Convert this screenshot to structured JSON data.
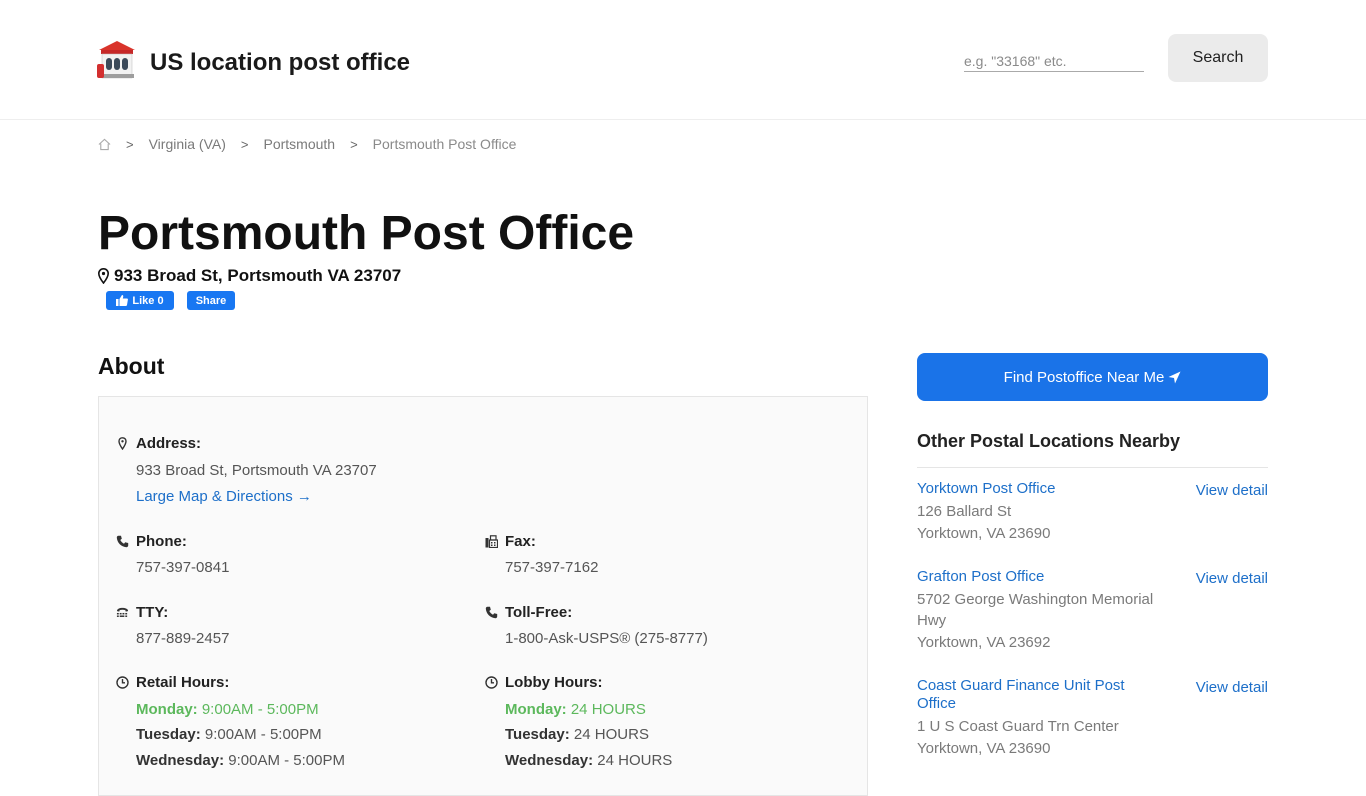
{
  "header": {
    "site_title": "US location post office",
    "search_placeholder": "e.g. \"33168\" etc.",
    "search_button": "Search"
  },
  "breadcrumb": {
    "items": [
      "Virginia (VA)",
      "Portsmouth"
    ],
    "current": "Portsmouth Post Office",
    "separator": ">"
  },
  "page": {
    "title": "Portsmouth Post Office",
    "address": "933 Broad St, Portsmouth VA 23707",
    "fb_like": "Like 0",
    "fb_share": "Share"
  },
  "about": {
    "title": "About",
    "address_label": "Address:",
    "address_value": "933 Broad St, Portsmouth VA 23707",
    "map_link": "Large Map & Directions →",
    "phone_label": "Phone:",
    "phone_value": "757-397-0841",
    "fax_label": "Fax:",
    "fax_value": "757-397-7162",
    "tty_label": "TTY:",
    "tty_value": "877-889-2457",
    "tollfree_label": "Toll-Free:",
    "tollfree_value": "1-800-Ask-USPS® (275-8777)",
    "retail_label": "Retail Hours:",
    "lobby_label": "Lobby Hours:",
    "retail_hours": [
      {
        "day": "Monday:",
        "time": "9:00AM - 5:00PM"
      },
      {
        "day": "Tuesday:",
        "time": "9:00AM - 5:00PM"
      },
      {
        "day": "Wednesday:",
        "time": "9:00AM - 5:00PM"
      }
    ],
    "lobby_hours": [
      {
        "day": "Monday:",
        "time": "24 HOURS"
      },
      {
        "day": "Tuesday:",
        "time": "24 HOURS"
      },
      {
        "day": "Wednesday:",
        "time": "24 HOURS"
      }
    ]
  },
  "sidebar": {
    "find_button": "Find Postoffice Near Me",
    "nearby_title": "Other Postal Locations Nearby",
    "view_detail": "View detail",
    "locations": [
      {
        "name": "Yorktown Post Office",
        "street": "126 Ballard St",
        "city": "Yorktown, VA 23690"
      },
      {
        "name": "Grafton Post Office",
        "street": "5702 George Washington Memorial Hwy",
        "city": "Yorktown, VA 23692"
      },
      {
        "name": "Coast Guard Finance Unit Post Office",
        "street": "1 U S Coast Guard Trn Center",
        "city": "Yorktown, VA 23690"
      }
    ]
  },
  "colors": {
    "link": "#1d6fc9",
    "today": "#5cb85c",
    "primary_button": "#1a73e8",
    "facebook": "#1877f2"
  },
  "icons": [
    "post-office-logo-icon",
    "home-icon",
    "map-pin-icon",
    "phone-icon",
    "fax-icon",
    "tty-icon",
    "clock-icon",
    "location-arrow-icon",
    "thumbs-up-icon"
  ]
}
